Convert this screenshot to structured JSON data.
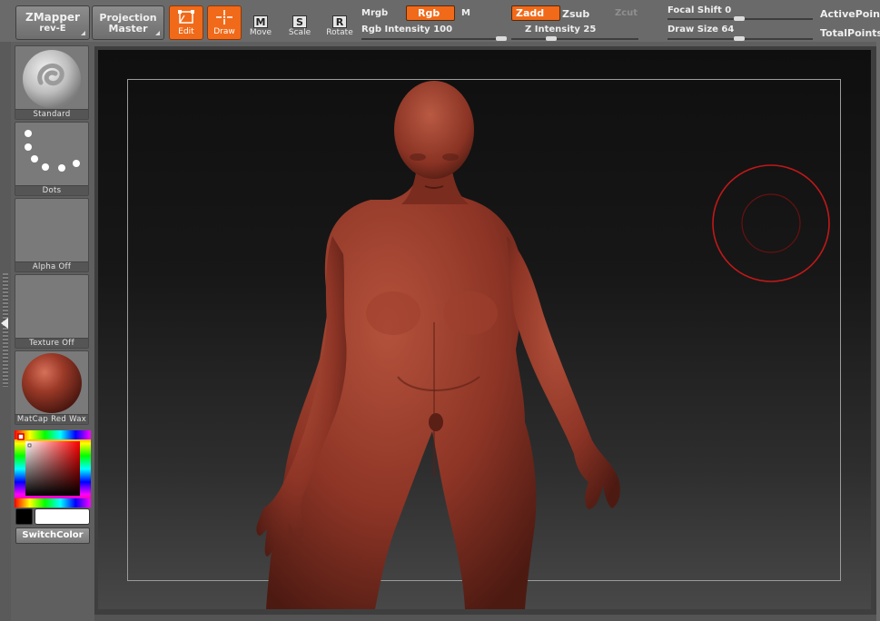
{
  "toolbar": {
    "zmapper": {
      "line1": "ZMapper",
      "line2": "rev-E"
    },
    "projection_master": {
      "line1": "Projection",
      "line2": "Master"
    },
    "edit_label": "Edit",
    "draw_label": "Draw",
    "move_label": "Move",
    "move_key": "M",
    "scale_label": "Scale",
    "scale_key": "S",
    "rotate_label": "Rotate",
    "rotate_key": "R",
    "mrgb_label": "Mrgb",
    "rgb_label": "Rgb",
    "m_label": "M",
    "zadd_label": "Zadd",
    "zsub_label": "Zsub",
    "zcut_label": "Zcut",
    "rgb_intensity_label": "Rgb Intensity",
    "rgb_intensity_value": "100",
    "z_intensity_label": "Z Intensity",
    "z_intensity_value": "25",
    "focal_shift_label": "Focal Shift",
    "focal_shift_value": "0",
    "draw_size_label": "Draw Size",
    "draw_size_value": "64",
    "active_points_label": "ActivePoint",
    "total_points_label": "TotalPoints"
  },
  "left_panel": {
    "brush_label": "Standard",
    "stroke_label": "Dots",
    "alpha_label": "Alpha  Off",
    "texture_label": "Texture  Off",
    "material_label": "MatCap  Red  Wax",
    "switch_color_label": "SwitchColor"
  },
  "colors": {
    "accent": "#f06a1a",
    "model": "#8e3526",
    "brush_cursor": "#c01818",
    "main_color": "#000000",
    "secondary_color": "#ffffff"
  },
  "icons": {
    "edit": "edit-icon",
    "draw": "draw-icon",
    "move": "move-icon",
    "scale": "scale-icon",
    "rotate": "rotate-icon"
  }
}
